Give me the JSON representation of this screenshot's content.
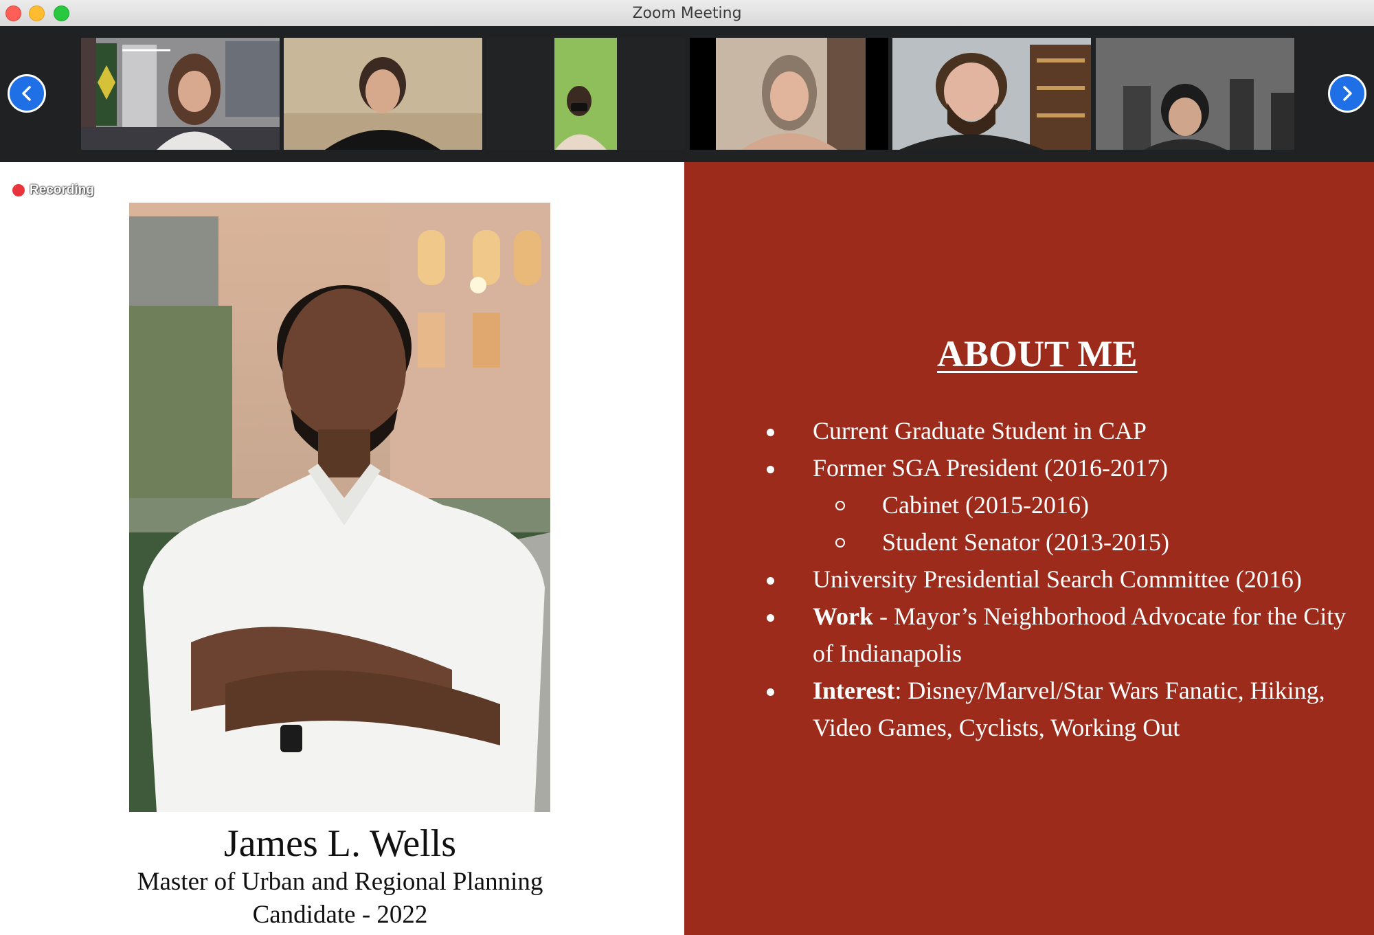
{
  "window": {
    "title": "Zoom Meeting"
  },
  "recording": {
    "label": "Recording"
  },
  "gallery": {
    "participants": [
      "participant-1",
      "participant-2",
      "participant-3",
      "participant-4",
      "participant-5",
      "participant-6"
    ]
  },
  "slide": {
    "name": "James L. Wells",
    "degree_line1": "Master of Urban and Regional Planning",
    "degree_line2": "Candidate - 2022",
    "about_title": "ABOUT ME",
    "bullets": [
      {
        "level": 1,
        "text": "Current Graduate Student in CAP"
      },
      {
        "level": 1,
        "text": "Former SGA President (2016-2017)"
      },
      {
        "level": 2,
        "text": "Cabinet (2015-2016)"
      },
      {
        "level": 2,
        "text": "Student Senator (2013-2015)"
      },
      {
        "level": 1,
        "text": "University Presidential Search Committee (2016)"
      },
      {
        "level": 1,
        "strong": "Work",
        "text": " - Mayor’s Neighborhood Advocate for the City of Indianapolis"
      },
      {
        "level": 1,
        "strong": "Interest",
        "text": ": Disney/Marvel/Star Wars Fanatic, Hiking, Video Games, Cyclists, Working Out"
      }
    ]
  },
  "colors": {
    "slide_accent": "#9c2b1c",
    "nav_button": "#1f6fe6",
    "recording_dot": "#e8353b"
  }
}
